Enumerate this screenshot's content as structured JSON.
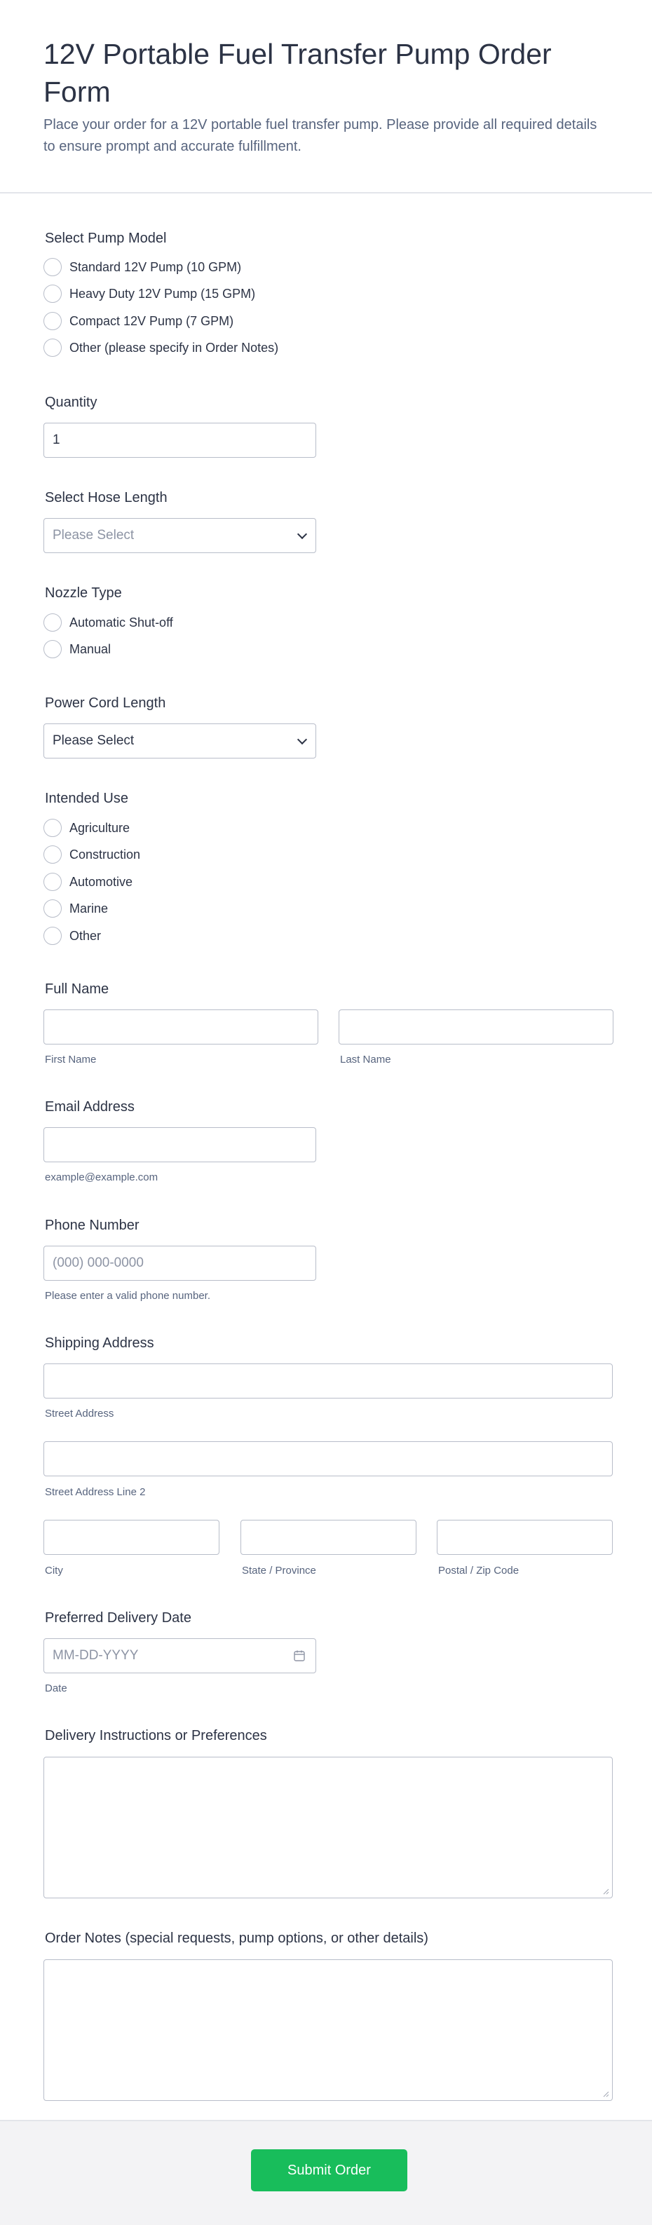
{
  "header": {
    "title": "12V Portable Fuel Transfer Pump Order Form",
    "subtitle": "Place your order for a 12V portable fuel transfer pump. Please provide all required details to ensure prompt and accurate fulfillment."
  },
  "pump_model": {
    "label": "Select Pump Model",
    "options": [
      "Standard 12V Pump (10 GPM)",
      "Heavy Duty 12V Pump (15 GPM)",
      "Compact 12V Pump (7 GPM)",
      "Other (please specify in Order Notes)"
    ]
  },
  "quantity": {
    "label": "Quantity",
    "value": "1"
  },
  "hose_length": {
    "label": "Select Hose Length",
    "placeholder": "Please Select"
  },
  "nozzle_type": {
    "label": "Nozzle Type",
    "options": [
      "Automatic Shut-off",
      "Manual"
    ]
  },
  "power_cord": {
    "label": "Power Cord Length",
    "value": "Please Select"
  },
  "intended_use": {
    "label": "Intended Use",
    "options": [
      "Agriculture",
      "Construction",
      "Automotive",
      "Marine",
      "Other"
    ]
  },
  "full_name": {
    "label": "Full Name",
    "first_sub": "First Name",
    "last_sub": "Last Name"
  },
  "email": {
    "label": "Email Address",
    "sub": "example@example.com"
  },
  "phone": {
    "label": "Phone Number",
    "placeholder": "(000) 000-0000",
    "sub": "Please enter a valid phone number."
  },
  "address": {
    "label": "Shipping Address",
    "street_sub": "Street Address",
    "street2_sub": "Street Address Line 2",
    "city_sub": "City",
    "state_sub": "State / Province",
    "zip_sub": "Postal / Zip Code"
  },
  "delivery_date": {
    "label": "Preferred Delivery Date",
    "placeholder": "MM-DD-YYYY",
    "sub": "Date",
    "icon": "calendar-icon"
  },
  "delivery_instructions": {
    "label": "Delivery Instructions or Preferences"
  },
  "order_notes": {
    "label": "Order Notes (special requests, pump options, or other details)"
  },
  "submit": {
    "label": "Submit Order",
    "color": "#18bd5b"
  }
}
